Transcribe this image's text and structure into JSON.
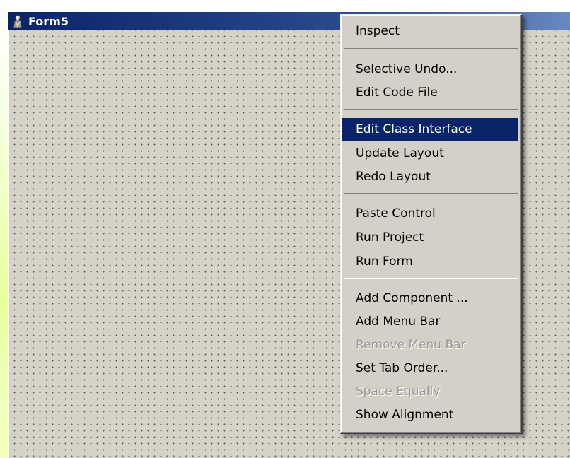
{
  "window": {
    "title": "Form5",
    "icon": "app-figure-icon"
  },
  "context_menu": {
    "items": [
      {
        "label": "Inspect",
        "enabled": true,
        "highlighted": false
      },
      {
        "label": "Selective Undo...",
        "enabled": true,
        "highlighted": false
      },
      {
        "label": "Edit Code File",
        "enabled": true,
        "highlighted": false
      },
      {
        "label": "Edit Class Interface",
        "enabled": true,
        "highlighted": true
      },
      {
        "label": "Update Layout",
        "enabled": true,
        "highlighted": false
      },
      {
        "label": "Redo Layout",
        "enabled": true,
        "highlighted": false
      },
      {
        "label": "Paste Control",
        "enabled": true,
        "highlighted": false
      },
      {
        "label": "Run Project",
        "enabled": true,
        "highlighted": false
      },
      {
        "label": "Run Form",
        "enabled": true,
        "highlighted": false
      },
      {
        "label": "Add Component ...",
        "enabled": true,
        "highlighted": false
      },
      {
        "label": "Add Menu Bar",
        "enabled": true,
        "highlighted": false
      },
      {
        "label": "Remove Menu Bar",
        "enabled": false,
        "highlighted": false
      },
      {
        "label": "Set Tab Order...",
        "enabled": true,
        "highlighted": false
      },
      {
        "label": "Space Equally",
        "enabled": false,
        "highlighted": false
      },
      {
        "label": "Show Alignment",
        "enabled": true,
        "highlighted": false
      }
    ]
  },
  "colors": {
    "title_bar": "#0a246a",
    "highlight": "#0a246a",
    "menu_background": "#d4d0c8",
    "form_background": "#d5d2c8",
    "disabled_text": "#9a9a9a"
  }
}
